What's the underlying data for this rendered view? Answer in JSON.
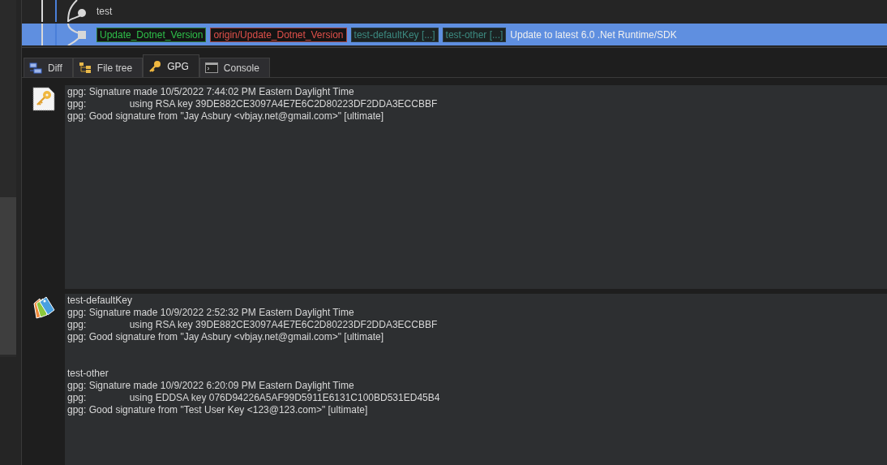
{
  "commits": [
    {
      "message": "test",
      "selected": false,
      "kind": "circle"
    },
    {
      "message": "Update to latest 6.0 .Net Runtime/SDK",
      "refs": [
        {
          "label": "Update_Dotnet_Version",
          "kind": "local"
        },
        {
          "label": "origin/Update_Dotnet_Version",
          "kind": "remote"
        },
        {
          "label": "test-defaultKey [...]",
          "kind": "tag"
        },
        {
          "label": "test-other [...]",
          "kind": "tag"
        }
      ],
      "selected": true,
      "kind": "square"
    }
  ],
  "tabs": [
    {
      "label": "Diff",
      "kind": "diff",
      "selected": false
    },
    {
      "label": "File tree",
      "kind": "tree",
      "selected": false
    },
    {
      "label": "GPG",
      "kind": "key",
      "selected": true
    },
    {
      "label": "Console",
      "kind": "console",
      "selected": false
    }
  ],
  "signatures": [
    {
      "kind": "commit",
      "sections": [
        {
          "lines": [
            "gpg: Signature made 10/5/2022 7:44:02 PM Eastern Daylight Time",
            "gpg:                using RSA key 39DE882CE3097A4E7E6C2D80223DF2DDA3ECCBBF",
            "gpg: Good signature from \"Jay Asbury <vbjay.net@gmail.com>\" [ultimate]"
          ]
        }
      ]
    },
    {
      "kind": "tag",
      "sections": [
        {
          "name": "test-defaultKey",
          "lines": [
            "gpg: Signature made 10/9/2022 2:52:32 PM Eastern Daylight Time",
            "gpg:                using RSA key 39DE882CE3097A4E7E6C2D80223DF2DDA3ECCBBF",
            "gpg: Good signature from \"Jay Asbury <vbjay.net@gmail.com>\" [ultimate]"
          ]
        },
        {
          "name": "test-other",
          "lines": [
            "gpg: Signature made 10/9/2022 6:20:09 PM Eastern Daylight Time",
            "gpg:                using EDDSA key 076D94226A5AF99D5911E6131C100BD531ED45B4",
            "gpg: Good signature from \"Test User Key <123@123.com>\" [ultimate]"
          ]
        }
      ]
    }
  ]
}
